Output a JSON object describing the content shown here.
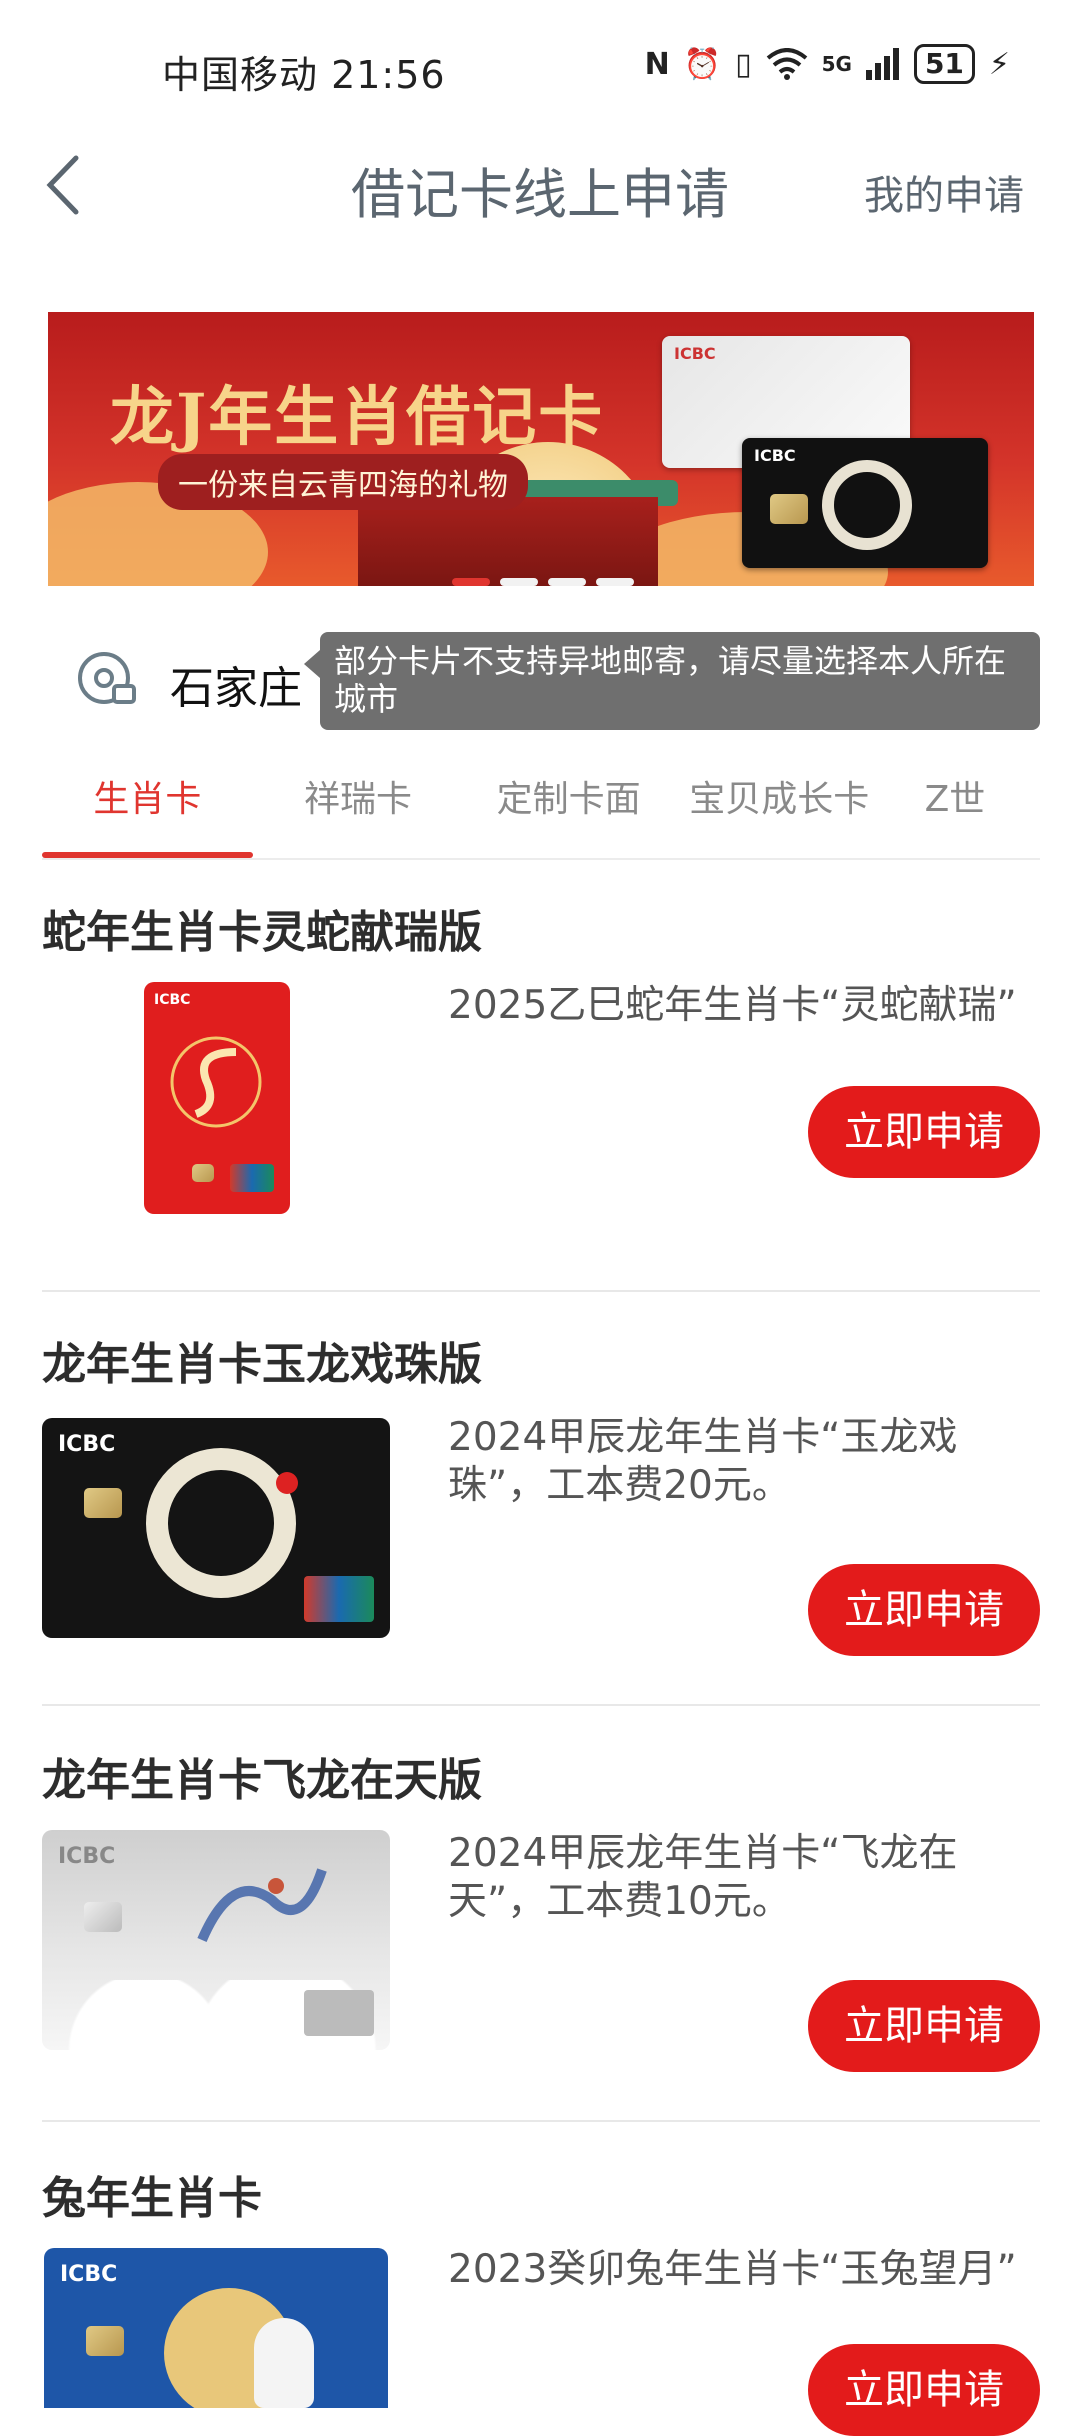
{
  "status": {
    "carrier_time": "中国移动 21:56",
    "icons": [
      "nfc-icon",
      "alarm-icon",
      "vibrate-icon",
      "wifi-icon",
      "signal-5g-icon"
    ],
    "net": "5G",
    "battery": "51"
  },
  "header": {
    "title": "借记卡线上申请",
    "right_link": "我的申请"
  },
  "banner": {
    "title": "龙J年生肖借记卡",
    "subtitle": "一份来自云青四海的礼物",
    "card_brand": "ICBC",
    "page_count": 4,
    "active_index": 0
  },
  "location": {
    "city": "石家庄",
    "tooltip": "部分卡片不支持异地邮寄，请尽量选择本人所在城市"
  },
  "tabs": [
    {
      "label": "生肖卡",
      "active": true
    },
    {
      "label": "祥瑞卡",
      "active": false
    },
    {
      "label": "定制卡面",
      "active": false
    },
    {
      "label": "宝贝成长卡",
      "active": false
    },
    {
      "label": "Z世",
      "active": false
    }
  ],
  "items": [
    {
      "title": "蛇年生肖卡灵蛇献瑞版",
      "desc": "2025乙巳蛇年生肖卡“灵蛇献瑞”",
      "button": "立即申请",
      "card_color": "#e01e1e"
    },
    {
      "title": "龙年生肖卡玉龙戏珠版",
      "desc": "2024甲辰龙年生肖卡“玉龙戏珠”，工本费20元。",
      "button": "立即申请",
      "card_color": "#141414"
    },
    {
      "title": "龙年生肖卡飞龙在天版",
      "desc": "2024甲辰龙年生肖卡“飞龙在天”，工本费10元。",
      "button": "立即申请",
      "card_color": "#dcdcdc"
    },
    {
      "title": "兔年生肖卡",
      "desc": "2023癸卯兔年生肖卡“玉兔望月”",
      "button": "立即申请",
      "card_color": "#1e56a8"
    }
  ],
  "card_labels": {
    "brand": "ICBC",
    "union_pay": "UnionPay",
    "union_pay_cn": "银联"
  }
}
